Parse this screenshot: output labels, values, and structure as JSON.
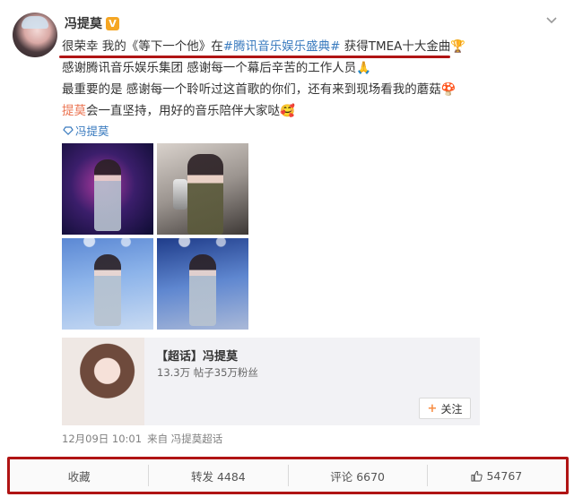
{
  "post": {
    "author": "冯提莫",
    "badge": "V",
    "lines": [
      {
        "pre": "很荣幸 我的《等下一个他》在",
        "hashtag": "#腾讯音乐娱乐盛典#",
        "post": " 获得TMEA十大金曲🏆"
      },
      {
        "text": "感谢腾讯音乐娱乐集团 感谢每一个幕后辛苦的工作人员🙏"
      },
      {
        "text": "最重要的是 感谢每一个聆听过这首歌的你们，还有来到现场看我的蘑菇🍄"
      },
      {
        "mention": "提莫",
        "text": "会一直坚持，用好的音乐陪伴大家哒🥰"
      }
    ],
    "source_tag": "冯提莫"
  },
  "card": {
    "title": "【超话】冯提莫",
    "stats": "13.3万 帖子35万粉丝",
    "follow_label": "关注"
  },
  "meta": {
    "time": "12月09日 10:01",
    "source": "来自 冯提莫超话"
  },
  "actions": {
    "favorite": "收藏",
    "repost": "转发 4484",
    "comment": "评论 6670",
    "like": "54767"
  },
  "colors": {
    "highlight_red": "#b01414",
    "link_blue": "#3a7bbf",
    "topic_orange": "#eb7350",
    "badge_gold": "#f5a623"
  }
}
